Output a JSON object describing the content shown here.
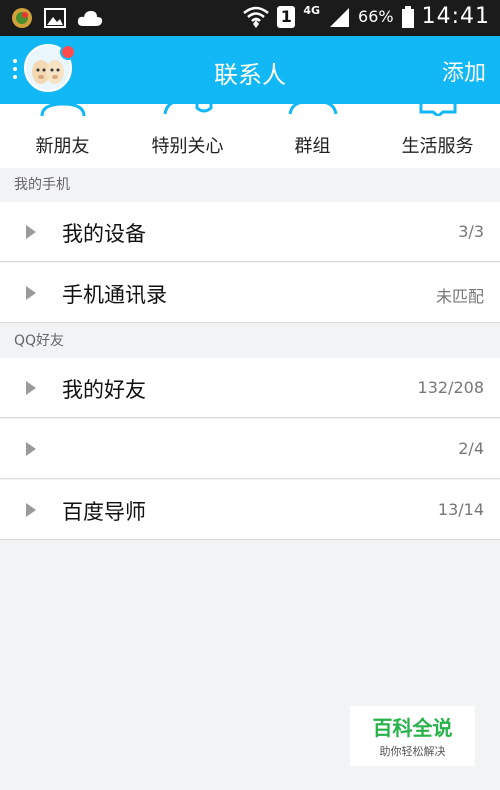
{
  "status_bar": {
    "icons": [
      "app-notification-icon",
      "image-icon",
      "cloud-icon"
    ],
    "sim_badge": "1",
    "network": "4G",
    "battery": "66%",
    "time": "14:41"
  },
  "header": {
    "title": "联系人",
    "add_label": "添加"
  },
  "quick_entries": [
    {
      "label": "新朋友",
      "icon": "new-friend-icon"
    },
    {
      "label": "特别关心",
      "icon": "special-care-icon"
    },
    {
      "label": "群组",
      "icon": "group-icon"
    },
    {
      "label": "生活服务",
      "icon": "life-service-icon"
    }
  ],
  "sections": [
    {
      "title": "我的手机",
      "items": [
        {
          "label": "我的设备",
          "count": "3/3"
        },
        {
          "label": "手机通讯录",
          "count": "未匹配"
        }
      ]
    },
    {
      "title": "QQ好友",
      "items": [
        {
          "label": "我的好友",
          "count": "132/208"
        },
        {
          "label": "",
          "count": "2/4"
        },
        {
          "label": "百度导师",
          "count": "13/14"
        }
      ]
    }
  ],
  "watermark": {
    "title": "百科全说",
    "subtitle": "助你轻松解决"
  },
  "colors": {
    "accent": "#12b7f5",
    "status_bar": "#1b1b1b",
    "background": "#f2f3f5"
  }
}
